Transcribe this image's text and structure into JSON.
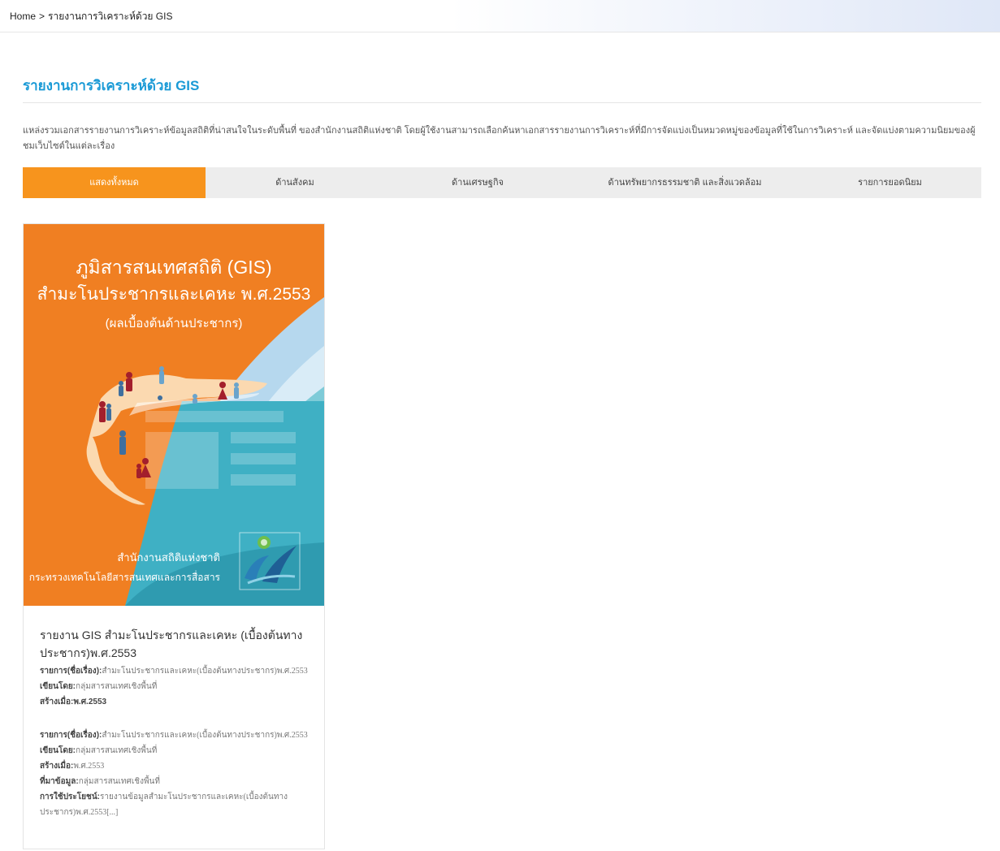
{
  "breadcrumb": {
    "home": "Home",
    "separator": ">",
    "current": "รายงานการวิเคราะห์ด้วย GIS"
  },
  "page": {
    "title": "รายงานการวิเคราะห์ด้วย GIS",
    "description": "แหล่งรวมเอกสารรายงานการวิเคราะห์ข้อมูลสถิติที่น่าสนใจในระดับพื้นที่ ของสำนักงานสถิติแห่งชาติ โดยผู้ใช้งานสามารถเลือกค้นหาเอกสารรายงานการวิเคราะห์ที่มีการจัดแบ่งเป็นหมวดหมู่ของข้อมูลที่ใช้ในการวิเคราะห์ และจัดแบ่งตามความนิยมของผู้ชมเว็บไซต์ในแต่ละเรื่อง"
  },
  "tabs": [
    {
      "label": "แสดงทั้งหมด",
      "active": true
    },
    {
      "label": "ด้านสังคม",
      "active": false
    },
    {
      "label": "ด้านเศรษฐกิจ",
      "active": false
    },
    {
      "label": "ด้านทรัพยากรธรรมชาติ และสิ่งแวดล้อม",
      "active": false
    },
    {
      "label": "รายการยอดนิยม",
      "active": false
    }
  ],
  "colors": {
    "accent": "#1a9ad6",
    "active_tab": "#f7941d",
    "cover_orange": "#f07f22",
    "cover_teal": "#3fb0c4"
  },
  "card": {
    "cover": {
      "title_line1": "ภูมิสารสนเทศสถิติ (GIS)",
      "title_line2": "สำมะโนประชากรและเคหะ พ.ศ.2553",
      "subtitle": "(ผลเบื้องต้นด้านประชากร)",
      "watermark": "GIS",
      "org_line1": "สำนักงานสถิติแห่งชาติ",
      "org_line2": "กระทรวงเทคโนโลยีสารสนเทศและการสื่อสาร",
      "logo": "nso-logo"
    },
    "title": "รายงาน GIS สำมะโนประชากรและเคหะ (เบื้องต้นทางประชากร)พ.ศ.2553",
    "meta_block_1": {
      "subject_key": "รายการ(ชื่อเรื่อง):",
      "subject_val": "สำมะโนประชากรและเคหะ(เบื้องต้นทางประชากร)พ.ศ.2553",
      "author_key": "เขียนโดย:",
      "author_val": "กลุ่มสารสนเทศเชิงพื้นที่",
      "created_garbled": "สร้างเมื่อ:พ.ศ.2553"
    },
    "meta_block_2": {
      "subject_key": "รายการ(ชื่อเรื่อง):",
      "subject_val": "สำมะโนประชากรและเคหะ(เบื้องต้นทางประชากร)พ.ศ.2553",
      "author_key": "เขียนโดย:",
      "author_val": "กลุ่มสารสนเทศเชิงพื้นที่",
      "created_key": "สร้างเมื่อ:",
      "created_val": "พ.ศ.2553",
      "source_key": "ที่มาข้อมูล:",
      "source_val": "กลุ่มสารสนเทศเชิงพื้นที่",
      "usage_key": "การใช้ประโยชน์:",
      "usage_val": "รายงานข้อมูลสำมะโนประชากรและเคหะ(เบื้องต้นทางประชากร)พ.ศ.2553[...]"
    }
  }
}
